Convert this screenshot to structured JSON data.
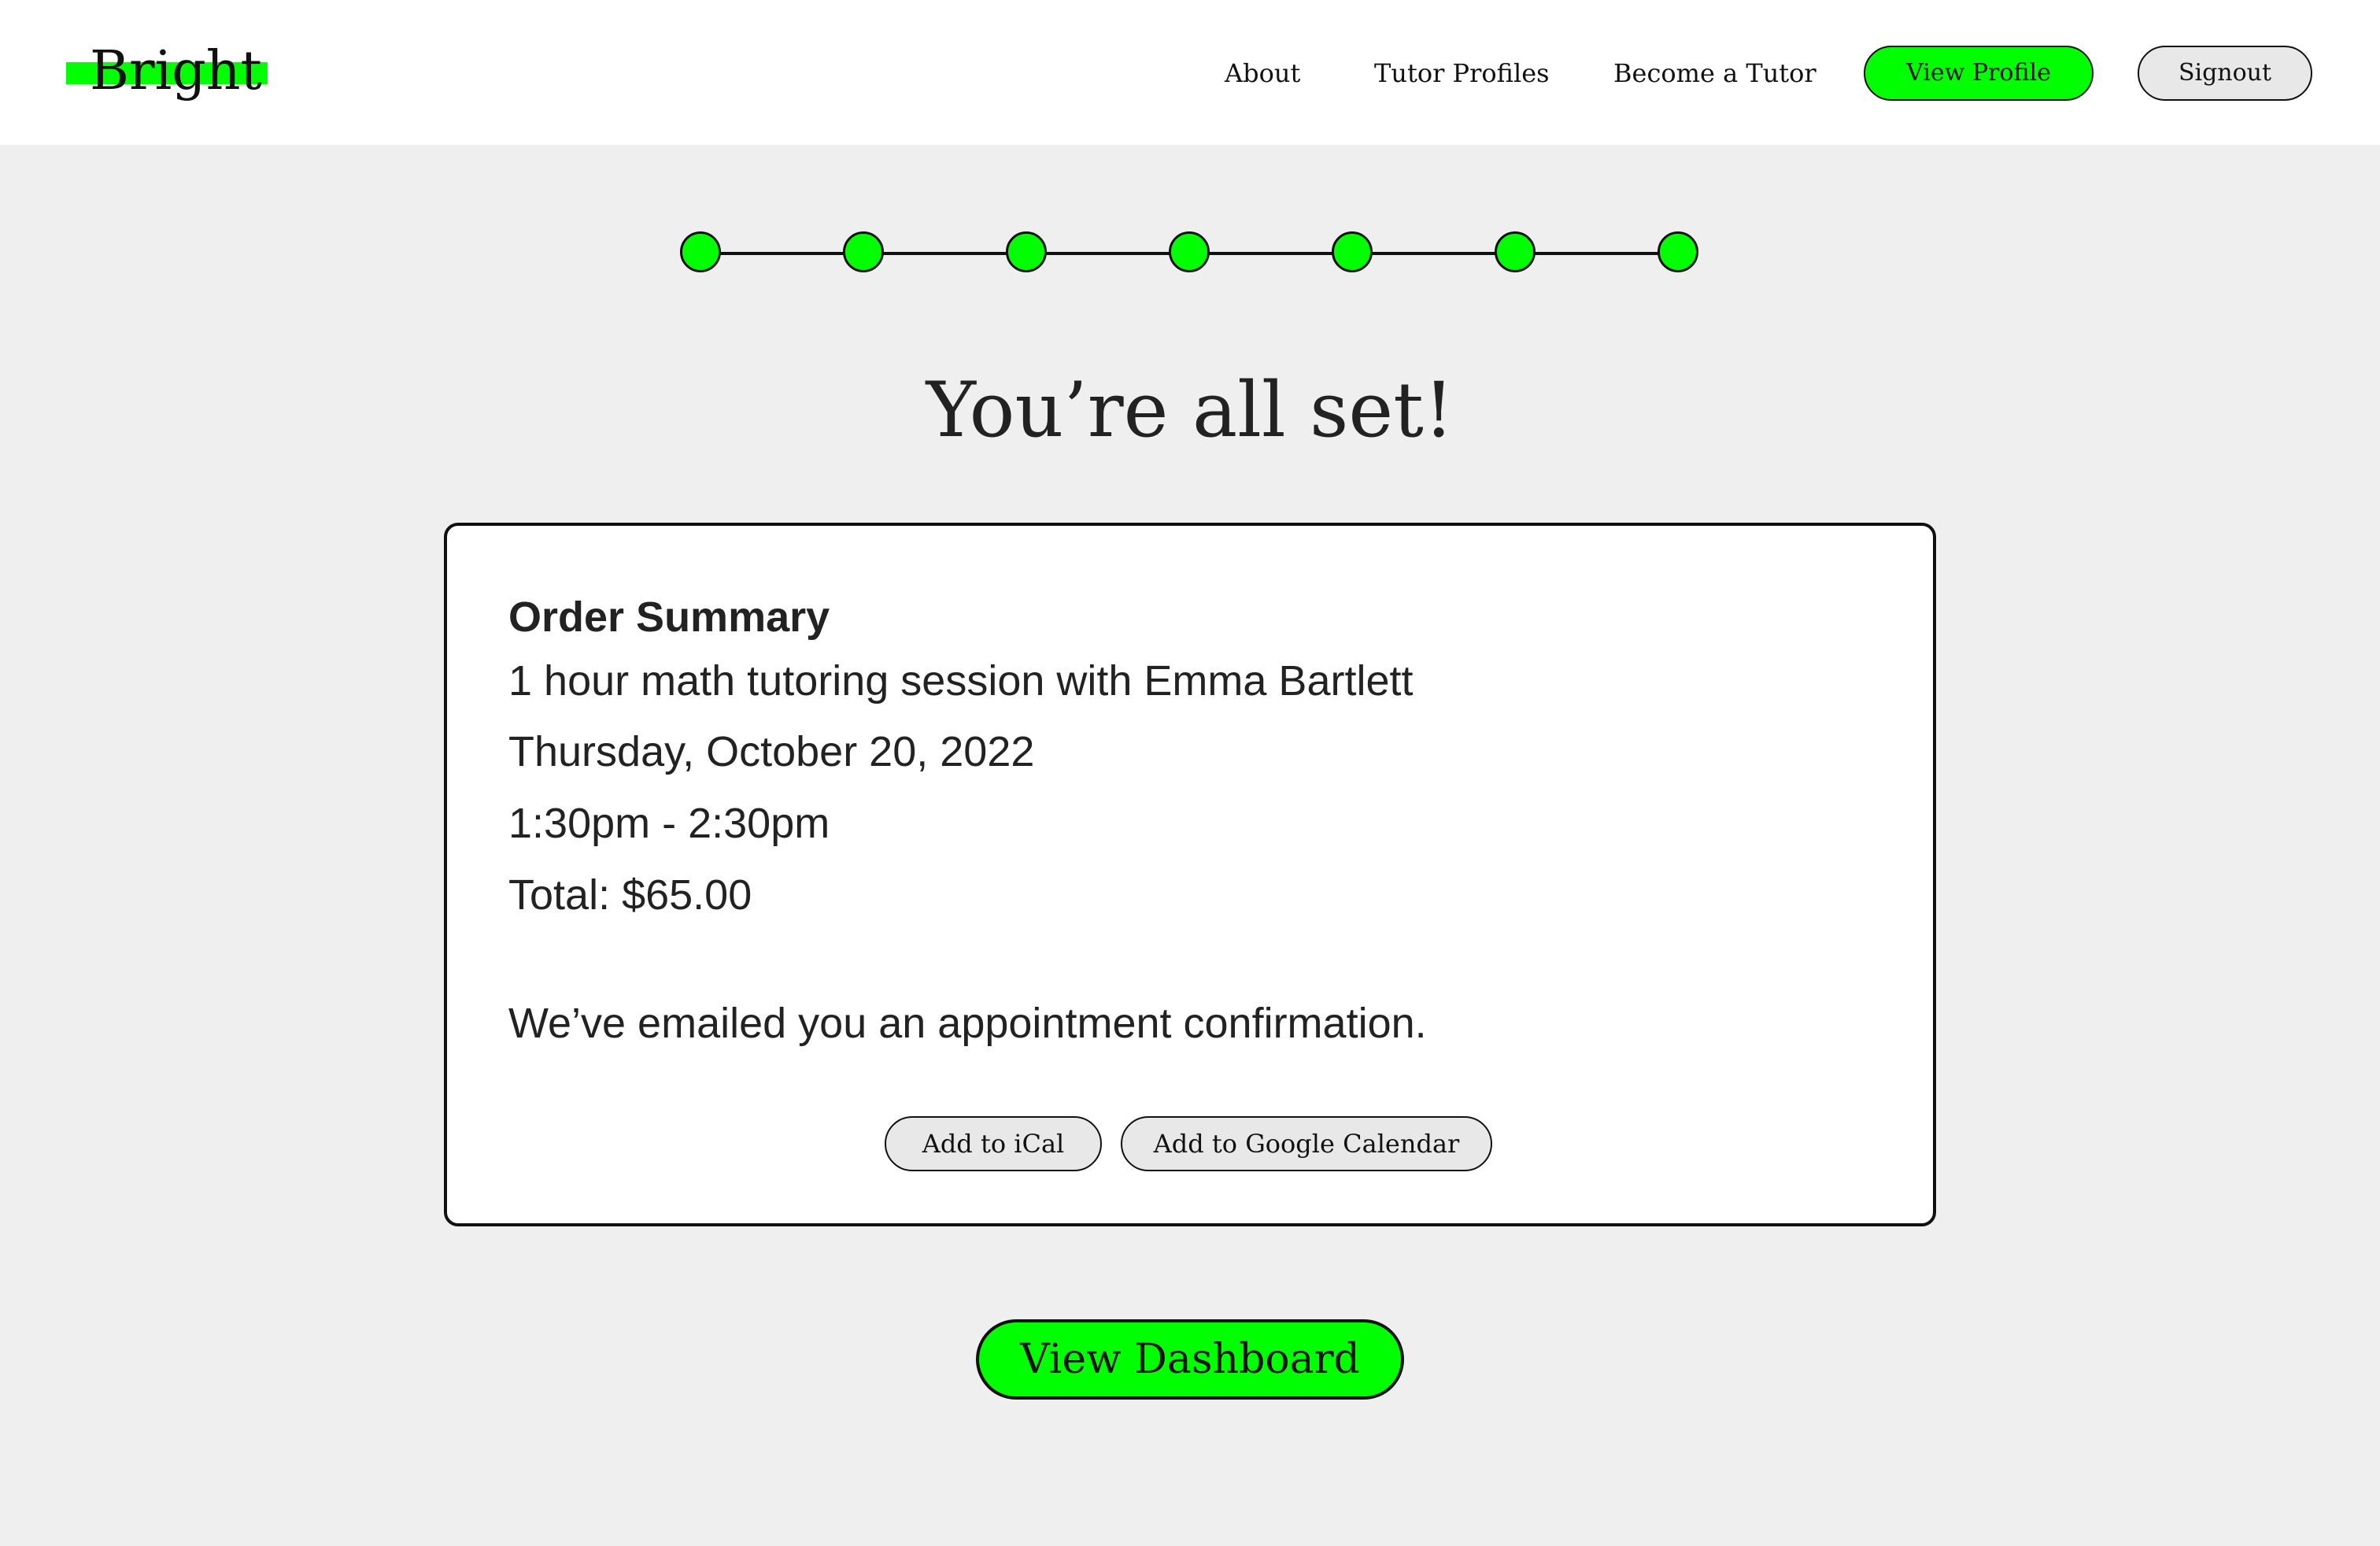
{
  "header": {
    "logo": "Bright",
    "nav": {
      "about": "About",
      "tutor_profiles": "Tutor Profiles",
      "become_tutor": "Become a Tutor"
    },
    "view_profile_label": "View Profile",
    "signout_label": "Signout"
  },
  "progress": {
    "total_steps": 7,
    "completed_steps": 7
  },
  "main": {
    "title": "You’re all set!",
    "order_summary": {
      "heading": "Order Summary",
      "session": "1 hour math tutoring session with Emma Bartlett",
      "date": "Thursday, October 20, 2022",
      "time": "1:30pm - 2:30pm",
      "total": "Total: $65.00"
    },
    "confirmation": "We’ve emailed you an appointment confirmation.",
    "add_ical_label": "Add to iCal",
    "add_google_label": "Add to Google Calendar",
    "dashboard_label": "View Dashboard"
  },
  "colors": {
    "accent": "#00ff00",
    "page_background": "#efefef",
    "card_background": "#ffffff",
    "button_gray": "#e8e8e8",
    "text": "#222222"
  }
}
